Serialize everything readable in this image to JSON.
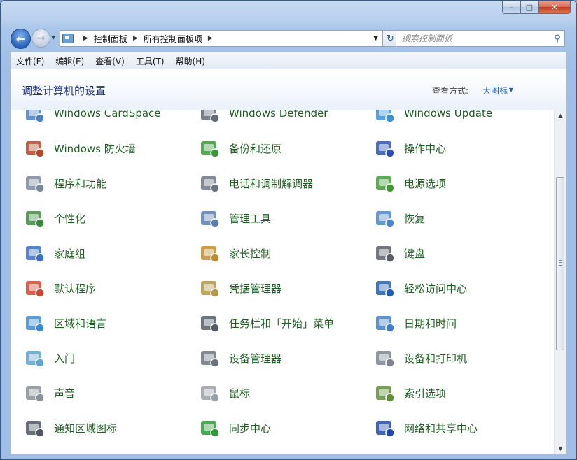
{
  "titlebar": {
    "minimize": "–",
    "maximize": "□",
    "close": "✕"
  },
  "nav": {
    "breadcrumb": [
      "控制面板",
      "所有控制面板项"
    ],
    "search_placeholder": "搜索控制面板"
  },
  "menu": [
    "文件(F)",
    "编辑(E)",
    "查看(V)",
    "工具(T)",
    "帮助(H)"
  ],
  "header": {
    "title": "调整计算机的设置",
    "view_label": "查看方式:",
    "view_value": "大图标"
  },
  "items": [
    {
      "label": "Windows CardSpace",
      "icon": "cardspace-icon",
      "color": "#4a7fc1"
    },
    {
      "label": "Windows Defender",
      "icon": "defender-icon",
      "color": "#606a78"
    },
    {
      "label": "Windows Update",
      "icon": "windows-update-icon",
      "color": "#3b8fd6"
    },
    {
      "label": "Windows 防火墙",
      "icon": "firewall-icon",
      "color": "#b5472a"
    },
    {
      "label": "备份和还原",
      "icon": "backup-icon",
      "color": "#3a9a3a"
    },
    {
      "label": "操作中心",
      "icon": "action-center-flag-icon",
      "color": "#2c53b3"
    },
    {
      "label": "程序和功能",
      "icon": "programs-icon",
      "color": "#7b8aa0"
    },
    {
      "label": "电话和调制解调器",
      "icon": "phone-modem-icon",
      "color": "#6b7584"
    },
    {
      "label": "电源选项",
      "icon": "power-battery-icon",
      "color": "#3f9c34"
    },
    {
      "label": "个性化",
      "icon": "personalization-icon",
      "color": "#3c8a3c"
    },
    {
      "label": "管理工具",
      "icon": "admin-tools-icon",
      "color": "#5a7faf"
    },
    {
      "label": "恢复",
      "icon": "recovery-icon",
      "color": "#4a88c9"
    },
    {
      "label": "家庭组",
      "icon": "homegroup-icon",
      "color": "#3b6fc4"
    },
    {
      "label": "家长控制",
      "icon": "parental-controls-icon",
      "color": "#c18c2a"
    },
    {
      "label": "键盘",
      "icon": "keyboard-icon",
      "color": "#5a5f66"
    },
    {
      "label": "默认程序",
      "icon": "default-programs-icon",
      "color": "#d0452f"
    },
    {
      "label": "凭据管理器",
      "icon": "credential-manager-icon",
      "color": "#b39746"
    },
    {
      "label": "轻松访问中心",
      "icon": "ease-of-access-icon",
      "color": "#1f5fb0"
    },
    {
      "label": "区域和语言",
      "icon": "region-language-icon",
      "color": "#3a8ad0"
    },
    {
      "label": "任务栏和「开始」菜单",
      "icon": "taskbar-icon",
      "color": "#555c66"
    },
    {
      "label": "日期和时间",
      "icon": "date-time-icon",
      "color": "#3e7fc8"
    },
    {
      "label": "入门",
      "icon": "getting-started-icon",
      "color": "#5ba4cf"
    },
    {
      "label": "设备管理器",
      "icon": "device-manager-icon",
      "color": "#6c7480"
    },
    {
      "label": "设备和打印机",
      "icon": "devices-printers-icon",
      "color": "#7d8590"
    },
    {
      "label": "声音",
      "icon": "sound-speaker-icon",
      "color": "#8a8f96"
    },
    {
      "label": "鼠标",
      "icon": "mouse-icon",
      "color": "#9aa0a8"
    },
    {
      "label": "索引选项",
      "icon": "indexing-icon",
      "color": "#5f8e3a"
    },
    {
      "label": "通知区域图标",
      "icon": "notification-area-icon",
      "color": "#4f5661"
    },
    {
      "label": "同步中心",
      "icon": "sync-center-icon",
      "color": "#2f9a3a"
    },
    {
      "label": "网络和共享中心",
      "icon": "network-sharing-icon",
      "color": "#1f4aa8"
    }
  ]
}
